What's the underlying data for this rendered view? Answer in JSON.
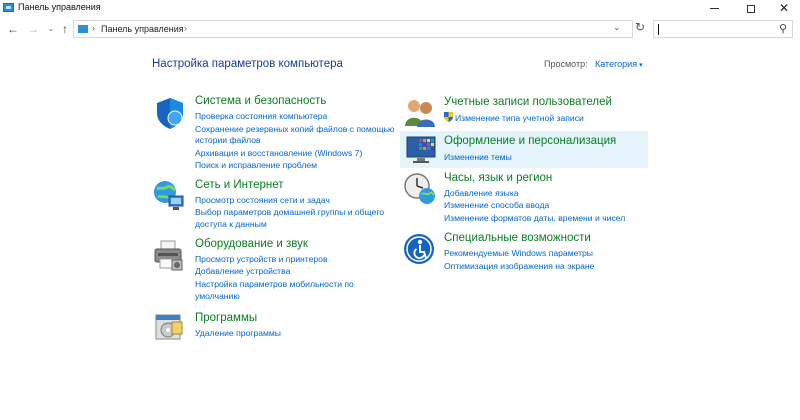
{
  "window": {
    "title": "Панель управления",
    "controls": {
      "minimize": "—",
      "maximize": "☐",
      "close": "✕"
    }
  },
  "address_bar": {
    "back": "←",
    "forward": "→",
    "recent": "⌄",
    "up": "↑",
    "separator": "›",
    "path": "Панель управления",
    "dropdown": "⌄",
    "refresh": "↻",
    "search_value": "",
    "search_icon": "⚲"
  },
  "header": {
    "title": "Настройка параметров компьютера",
    "view_label": "Просмотр:",
    "view_value": "Категория",
    "view_caret": "▾"
  },
  "categories": [
    {
      "title": "Система и безопасность",
      "icon": "shield-icon",
      "links": [
        "Проверка состояния компьютера",
        "Сохранение резервных копий файлов с помощью",
        "истории файлов",
        "Архивация и восстановление (Windows 7)",
        "Поиск и исправление проблем"
      ]
    },
    {
      "title": "Сеть и Интернет",
      "icon": "network-globe-icon",
      "links": [
        "Просмотр состояния сети и задач",
        "Выбор параметров домашней группы и общего",
        "доступа к данным"
      ]
    },
    {
      "title": "Оборудование и звук",
      "icon": "printer-icon",
      "links": [
        "Просмотр устройств и принтеров",
        "Добавление устройства",
        "Настройка параметров мобильности по",
        "умолчанию"
      ]
    },
    {
      "title": "Программы",
      "icon": "programs-icon",
      "links": [
        "Удаление программы"
      ]
    },
    {
      "title": "Учетные записи пользователей",
      "icon": "users-icon",
      "links": [
        "Изменение типа учетной записи"
      ]
    },
    {
      "title": "Оформление и персонализация",
      "icon": "personalization-icon",
      "links": [
        "Изменение темы"
      ]
    },
    {
      "title": "Часы, язык и регион",
      "icon": "clock-globe-icon",
      "links": [
        "Добавление языка",
        "Изменение способа ввода",
        "Изменение форматов даты, времени и чисел"
      ]
    },
    {
      "title": "Специальные возможности",
      "icon": "accessibility-icon",
      "links": [
        "Рекомендуемые Windows параметры",
        "Оптимизация изображения на экране"
      ]
    }
  ],
  "colors": {
    "category_title": "#0a7d22",
    "link": "#0066cc",
    "page_title": "#1a3d8f",
    "hover_highlight": "#e5f3fb"
  }
}
